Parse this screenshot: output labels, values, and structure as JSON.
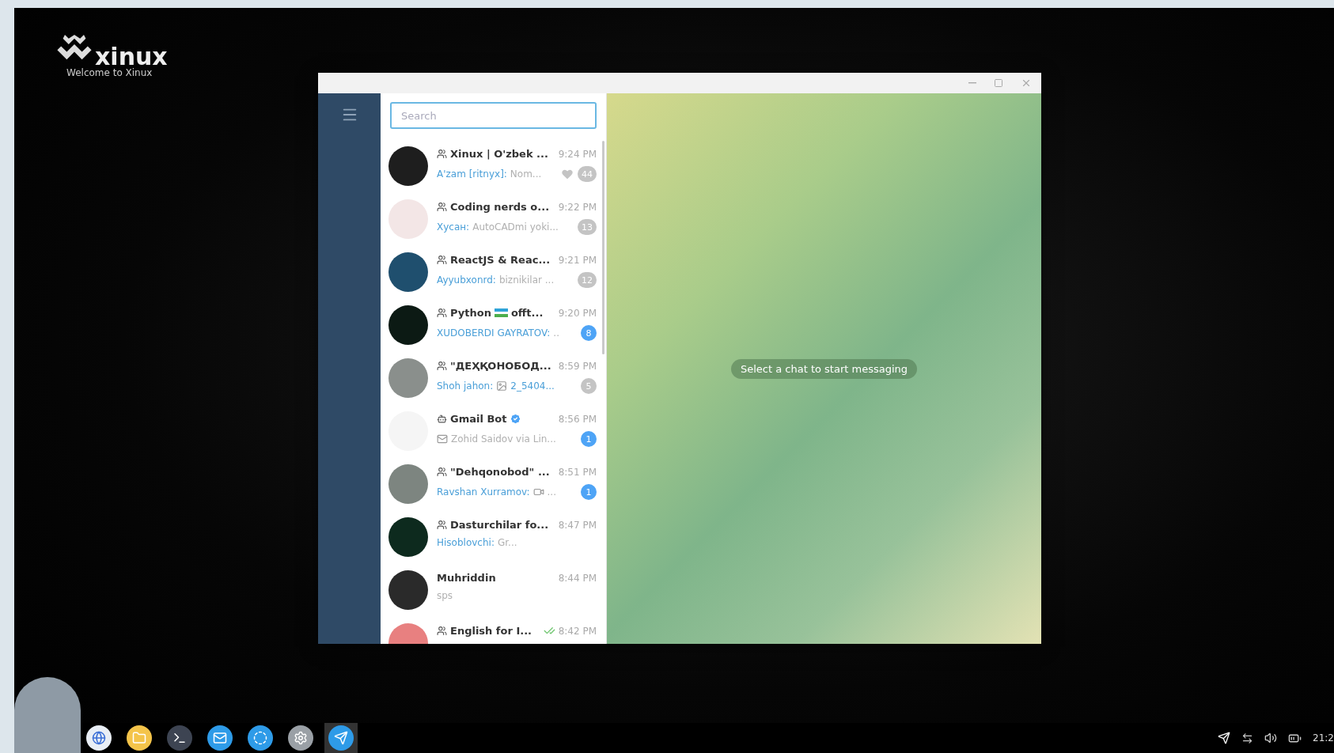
{
  "desktop": {
    "logo": {
      "name": "xinux",
      "subtitle": "Welcome to Xinux"
    }
  },
  "search": {
    "placeholder": "Search"
  },
  "chats": [
    {
      "kind": "group",
      "title": "Xinux | O'zbek ...",
      "time": "9:24 PM",
      "sender": "A'zam [ritnyx]:",
      "preview": "Nom...",
      "reaction": true,
      "verified": false,
      "sent_read": false,
      "badge": "44",
      "muted": true,
      "color": "#1e1e1e"
    },
    {
      "kind": "group",
      "title": "Coding nerds o...",
      "time": "9:22 PM",
      "sender": "Хусан:",
      "preview": "AutoCADmi yoki...",
      "reaction": false,
      "verified": false,
      "sent_read": false,
      "badge": "13",
      "muted": true,
      "color": "#f3e6e6"
    },
    {
      "kind": "group",
      "title": "ReactJS & Reac...",
      "time": "9:21 PM",
      "sender": "Ayyubxonrd:",
      "preview": "biznikilar ...",
      "reaction": false,
      "verified": false,
      "sent_read": false,
      "badge": "12",
      "muted": true,
      "color": "#1f4f6e"
    },
    {
      "kind": "group",
      "title": "Python",
      "title_tail": "offt...",
      "time": "9:20 PM",
      "sender": "XUDOBERDI GAYRATOV:",
      "preview": "..",
      "reaction": false,
      "verified": false,
      "sent_read": false,
      "badge": "8",
      "muted": false,
      "color": "#0c1a14"
    },
    {
      "kind": "group",
      "title": "\"ДЕҲҚОНОБОД...",
      "time": "8:59 PM",
      "sender": "Shoh jahon:",
      "attachment": {
        "kind": "photo"
      },
      "preview": "2_5404...",
      "preview_blue": true,
      "reaction": false,
      "verified": false,
      "sent_read": false,
      "badge": "5",
      "muted": true,
      "color": "#8a8f8c"
    },
    {
      "kind": "bot",
      "title": "Gmail Bot",
      "time": "8:56 PM",
      "attachment": {
        "kind": "mail"
      },
      "preview": "Zohid Saidov via Lin...",
      "reaction": false,
      "verified": true,
      "sent_read": false,
      "badge": "1",
      "muted": false,
      "color": "#f5f5f5"
    },
    {
      "kind": "group",
      "title": "\"Dehqonobod\" ...",
      "time": "8:51 PM",
      "sender": "Ravshan Xurramov:",
      "attachment": {
        "kind": "video"
      },
      "preview": "...",
      "reaction": false,
      "verified": false,
      "sent_read": false,
      "badge": "1",
      "muted": false,
      "color": "#7d8580"
    },
    {
      "kind": "group",
      "title": "Dasturchilar fo...",
      "time": "8:47 PM",
      "sender": "Hisoblovchi:",
      "preview": "Gr...",
      "reaction": false,
      "verified": false,
      "sent_read": false,
      "color": "#0d2a1e"
    },
    {
      "kind": "user",
      "title": "Muhriddin",
      "time": "8:44 PM",
      "preview": "sps",
      "reaction": false,
      "verified": false,
      "sent_read": false,
      "color": "#2a2a2a"
    },
    {
      "kind": "group",
      "title": "English for I...",
      "time": "8:42 PM",
      "reaction": false,
      "verified": false,
      "sent_read": true,
      "color": "#e88080"
    }
  ],
  "chat_area": {
    "empty_message": "Select a chat to start messaging"
  },
  "taskbar": {
    "apps": [
      {
        "kind": "browser",
        "selected": false
      },
      {
        "kind": "folder",
        "selected": false
      },
      {
        "kind": "terminal",
        "selected": false
      },
      {
        "kind": "mail",
        "selected": false
      },
      {
        "kind": "cleaner",
        "selected": false
      },
      {
        "kind": "settings",
        "selected": false
      },
      {
        "kind": "telegram",
        "selected": true
      }
    ],
    "clock": "21:2"
  }
}
